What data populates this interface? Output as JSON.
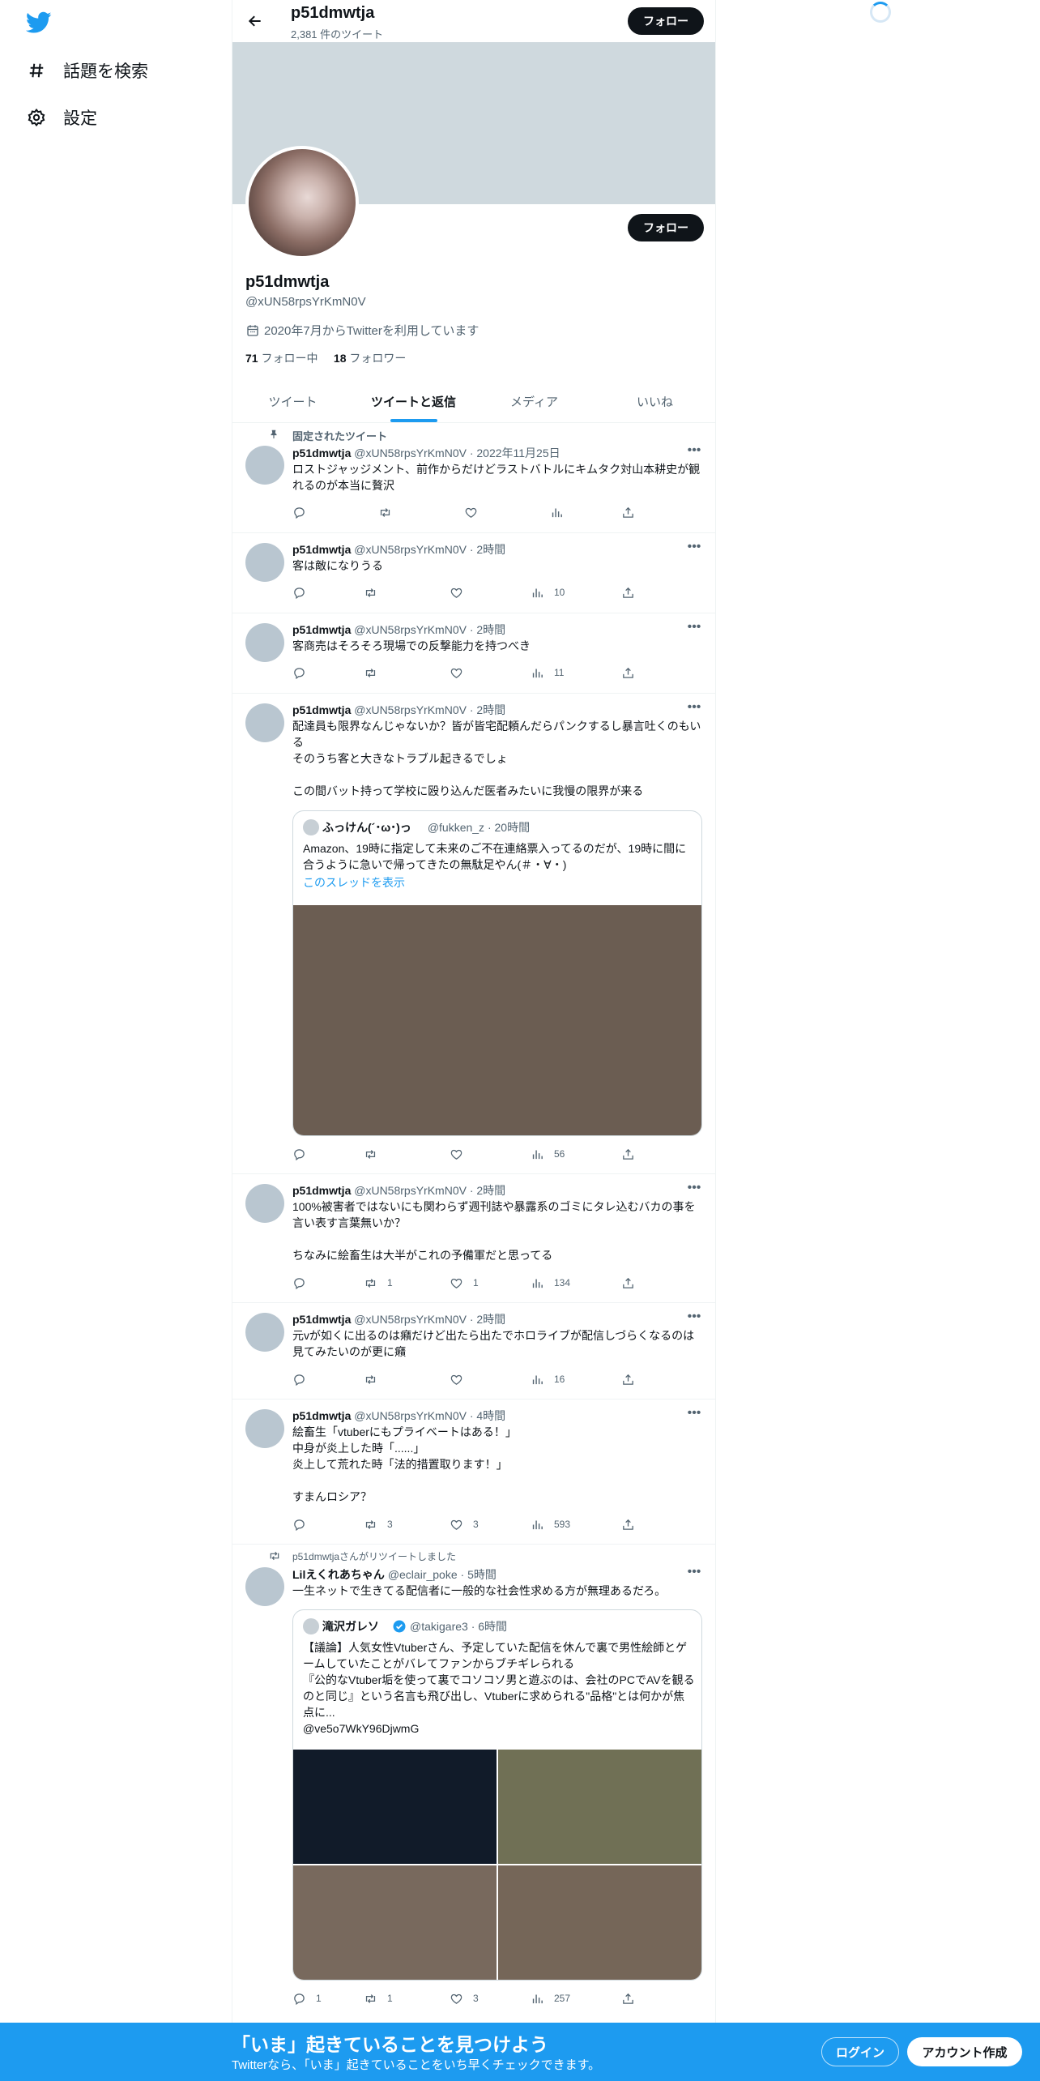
{
  "colors": {
    "accent": "#1d9bf0",
    "text": "#0f1419",
    "muted": "#536471",
    "banner": "#cfd9de"
  },
  "nav": {
    "items": [
      {
        "label": "話題を検索",
        "icon": "hashtag-icon"
      },
      {
        "label": "設定",
        "icon": "gear-icon"
      }
    ]
  },
  "header": {
    "name": "p51dmwtja",
    "tweet_count": "2,381 件のツイート",
    "follow_label": "フォロー"
  },
  "profile": {
    "name": "p51dmwtja",
    "handle": "@xUN58rpsYrKmN0V",
    "joined": "2020年7月からTwitterを利用しています",
    "following_count": "71",
    "following_label": "フォロー中",
    "followers_count": "18",
    "followers_label": "フォロワー",
    "follow_label": "フォロー"
  },
  "tabs": [
    "ツイート",
    "ツイートと返信",
    "メディア",
    "いいね"
  ],
  "tweets": [
    {
      "pinned": "固定されたツイート",
      "name": "p51dmwtja",
      "meta": "@xUN58rpsYrKmN0V · 2022年11月25日",
      "text": "ロストジャッジメント、前作からだけどラストバトルにキムタク対山本耕史が観れるのが本当に贅沢",
      "retweets": "",
      "likes": "",
      "views": ""
    },
    {
      "name": "p51dmwtja",
      "meta": "@xUN58rpsYrKmN0V · 2時間",
      "text": "客は敵になりうる",
      "retweets": "",
      "likes": "",
      "views": "10"
    },
    {
      "name": "p51dmwtja",
      "meta": "@xUN58rpsYrKmN0V · 2時間",
      "text": "客商売はそろそろ現場での反撃能力を持つべき",
      "retweets": "",
      "likes": "",
      "views": "11"
    },
    {
      "name": "p51dmwtja",
      "meta": "@xUN58rpsYrKmN0V · 2時間",
      "text": "配達員も限界なんじゃないか？皆が皆宅配頼んだらパンクするし暴言吐くのもいる\nそのうち客と大きなトラブル起きるでしょ\n\nこの間バット持って学校に殴り込んだ医者みたいに我慢の限界が来る",
      "quote": {
        "name": "ふっけん(´･ω･)っ",
        "meta": "@fukken_z · 20時間",
        "text": "Amazon、19時に指定して未来のご不在連絡票入ってるのだが、19時に間に合うように急いで帰ってきたの無駄足やん(＃・∀・)",
        "link": "このスレッドを表示",
        "image_color": "#6b5d52"
      },
      "retweets": "",
      "likes": "",
      "views": "56"
    },
    {
      "name": "p51dmwtja",
      "meta": "@xUN58rpsYrKmN0V · 2時間",
      "text": "100%被害者ではないにも関わらず週刊誌や暴露系のゴミにタレ込むバカの事を言い表す言葉無いか？\n\nちなみに絵畜生は大半がこれの予備軍だと思ってる",
      "retweets": "1",
      "likes": "1",
      "views": "134"
    },
    {
      "name": "p51dmwtja",
      "meta": "@xUN58rpsYrKmN0V · 2時間",
      "text": "元vが如くに出るのは癪だけど出たら出たでホロライブが配信しづらくなるのは見てみたいのが更に癪",
      "retweets": "",
      "likes": "",
      "views": "16"
    },
    {
      "name": "p51dmwtja",
      "meta": "@xUN58rpsYrKmN0V · 4時間",
      "text": "絵畜生「vtuberにもプライベートはある！」\n中身が炎上した時「......」\n炎上して荒れた時「法的措置取ります！」\n\nすまんロシア？",
      "retweets": "3",
      "likes": "3",
      "views": "593"
    },
    {
      "retweeted_by": "p51dmwtjaさんがリツイートしました",
      "name": "Lilえくれあちゃん",
      "meta": "@eclair_poke · 5時間",
      "text": "一生ネットで生きてる配信者に一般的な社会性求める方が無理あるだろ。",
      "quote": {
        "name": "滝沢ガレソ",
        "verified": true,
        "meta": "@takigare3 · 6時間",
        "text": "【議論】人気女性Vtuberさん、予定していた配信を休んで裏で男性絵師とゲームしていたことがバレてファンからブチギレられる\n『公的なVtuber垢を使って裏でコソコソ男と遊ぶのは、会社のPCでAVを観るのと同じ』という名言も飛び出し、Vtuberに求められる\"品格\"とは何かが焦点に...\n@ve5o7WkY96DjwmG",
        "images": [
          "#111b29",
          "#707055",
          "#78695d",
          "#756658"
        ]
      },
      "replies": "1",
      "retweets": "1",
      "likes": "3",
      "views": "257"
    }
  ],
  "bottom_bar": {
    "title": "「いま」起きていることを見つけよう",
    "subtitle": "Twitterなら、「いま」起きていることをいち早くチェックできます。",
    "login": "ログイン",
    "signup": "アカウント作成"
  }
}
